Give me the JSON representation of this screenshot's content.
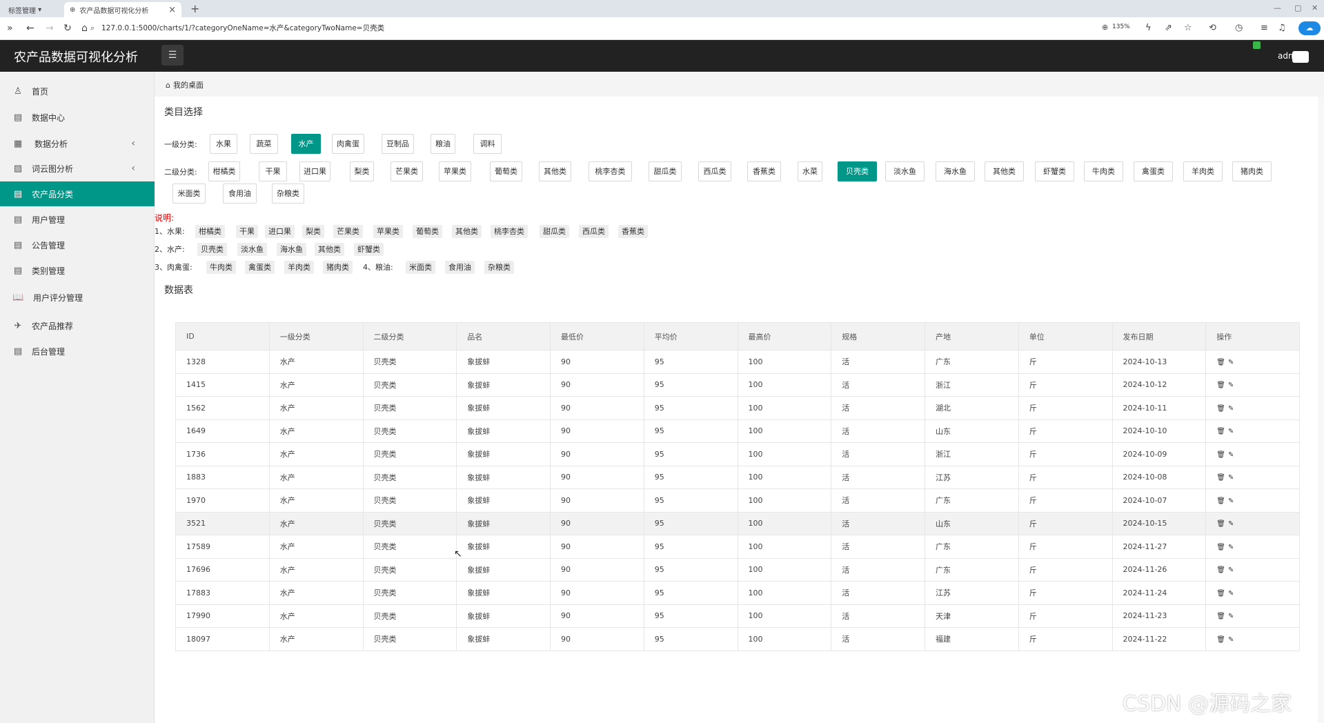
{
  "browser": {
    "tab1_label": "标签管理",
    "tab2_label": "农产品数据可视化分析",
    "url": "127.0.0.1:5000/charts/1/?categoryOneName=水产&categoryTwoName=贝壳类",
    "zoom": "135%"
  },
  "header": {
    "title": "农产品数据可视化分析",
    "user": "adm"
  },
  "sidebar": {
    "items": [
      {
        "label": "首页",
        "icon": "user-icon"
      },
      {
        "label": "数据中心",
        "icon": "doc-icon"
      },
      {
        "label": "数据分析",
        "icon": "table-icon"
      },
      {
        "label": "词云图分析",
        "icon": "image-icon"
      },
      {
        "label": "农产品分类",
        "icon": "doc-icon"
      },
      {
        "label": "用户管理",
        "icon": "doc-icon"
      },
      {
        "label": "公告管理",
        "icon": "doc-icon"
      },
      {
        "label": "类别管理",
        "icon": "doc-icon"
      },
      {
        "label": "用户评分管理",
        "icon": "book-icon"
      },
      {
        "label": "农产品推荐",
        "icon": "plane-icon"
      },
      {
        "label": "后台管理",
        "icon": "doc-icon"
      }
    ]
  },
  "breadcrumb": "我的桌面",
  "category_section_title": "类目选择",
  "level1_label": "一级分类:",
  "level1": [
    "水果",
    "蔬菜",
    "水产",
    "肉禽蛋",
    "豆制品",
    "粮油",
    "调料"
  ],
  "level1_selected": "水产",
  "level2_label": "二级分类:",
  "level2": [
    "柑橘类",
    "干果",
    "进口果",
    "梨类",
    "芒果类",
    "苹果类",
    "葡萄类",
    "其他类",
    "桃李杏类",
    "甜瓜类",
    "西瓜类",
    "香蕉类",
    "水菜",
    "贝壳类",
    "淡水鱼",
    "海水鱼",
    "其他类",
    "虾蟹类",
    "牛肉类",
    "禽蛋类",
    "羊肉类",
    "猪肉类",
    "米面类",
    "食用油",
    "杂粮类"
  ],
  "level2_selected": "贝壳类",
  "notes": {
    "title": "说明:",
    "line1_prefix": "1、水果:",
    "line1_tags": [
      "柑橘类",
      "干果",
      "进口果",
      "梨类",
      "芒果类",
      "苹果类",
      "葡萄类",
      "其他类",
      "桃李杏类",
      "甜瓜类",
      "西瓜类",
      "香蕉类"
    ],
    "line2_prefix": "2、水产:",
    "line2_tags": [
      "贝壳类",
      "淡水鱼",
      "海水鱼",
      "其他类",
      "虾蟹类"
    ],
    "line3_prefix": "3、肉禽蛋:",
    "line3_tags": [
      "牛肉类",
      "禽蛋类",
      "羊肉类",
      "猪肉类"
    ],
    "line3_prefix2": "4、粮油:",
    "line3_tags2": [
      "米面类",
      "食用油",
      "杂粮类"
    ]
  },
  "table_section_title": "数据表",
  "table": {
    "headers": [
      "ID",
      "一级分类",
      "二级分类",
      "品名",
      "最低价",
      "平均价",
      "最高价",
      "规格",
      "产地",
      "单位",
      "发布日期",
      "操作"
    ],
    "rows": [
      [
        "1328",
        "水产",
        "贝壳类",
        "象拔蚌",
        "90",
        "95",
        "100",
        "活",
        "广东",
        "斤",
        "2024-10-13"
      ],
      [
        "1415",
        "水产",
        "贝壳类",
        "象拔蚌",
        "90",
        "95",
        "100",
        "活",
        "浙江",
        "斤",
        "2024-10-12"
      ],
      [
        "1562",
        "水产",
        "贝壳类",
        "象拔蚌",
        "90",
        "95",
        "100",
        "活",
        "湖北",
        "斤",
        "2024-10-11"
      ],
      [
        "1649",
        "水产",
        "贝壳类",
        "象拔蚌",
        "90",
        "95",
        "100",
        "活",
        "山东",
        "斤",
        "2024-10-10"
      ],
      [
        "1736",
        "水产",
        "贝壳类",
        "象拔蚌",
        "90",
        "95",
        "100",
        "活",
        "浙江",
        "斤",
        "2024-10-09"
      ],
      [
        "1883",
        "水产",
        "贝壳类",
        "象拔蚌",
        "90",
        "95",
        "100",
        "活",
        "江苏",
        "斤",
        "2024-10-08"
      ],
      [
        "1970",
        "水产",
        "贝壳类",
        "象拔蚌",
        "90",
        "95",
        "100",
        "活",
        "广东",
        "斤",
        "2024-10-07"
      ],
      [
        "3521",
        "水产",
        "贝壳类",
        "象拔蚌",
        "90",
        "95",
        "100",
        "活",
        "山东",
        "斤",
        "2024-10-15"
      ],
      [
        "17589",
        "水产",
        "贝壳类",
        "象拔蚌",
        "90",
        "95",
        "100",
        "活",
        "广东",
        "斤",
        "2024-11-27"
      ],
      [
        "17696",
        "水产",
        "贝壳类",
        "象拔蚌",
        "90",
        "95",
        "100",
        "活",
        "广东",
        "斤",
        "2024-11-26"
      ],
      [
        "17883",
        "水产",
        "贝壳类",
        "象拔蚌",
        "90",
        "95",
        "100",
        "活",
        "江苏",
        "斤",
        "2024-11-24"
      ],
      [
        "17990",
        "水产",
        "贝壳类",
        "象拔蚌",
        "90",
        "95",
        "100",
        "活",
        "天津",
        "斤",
        "2024-11-23"
      ],
      [
        "18097",
        "水产",
        "贝壳类",
        "象拔蚌",
        "90",
        "95",
        "100",
        "活",
        "福建",
        "斤",
        "2024-11-22"
      ]
    ],
    "highlight_row": 7,
    "op_icons": [
      "trash-icon",
      "edit-icon"
    ]
  },
  "watermark": "CSDN @源码之家",
  "colors": {
    "accent": "#009688",
    "header_bg": "#222222",
    "note_red": "#dd0000"
  }
}
